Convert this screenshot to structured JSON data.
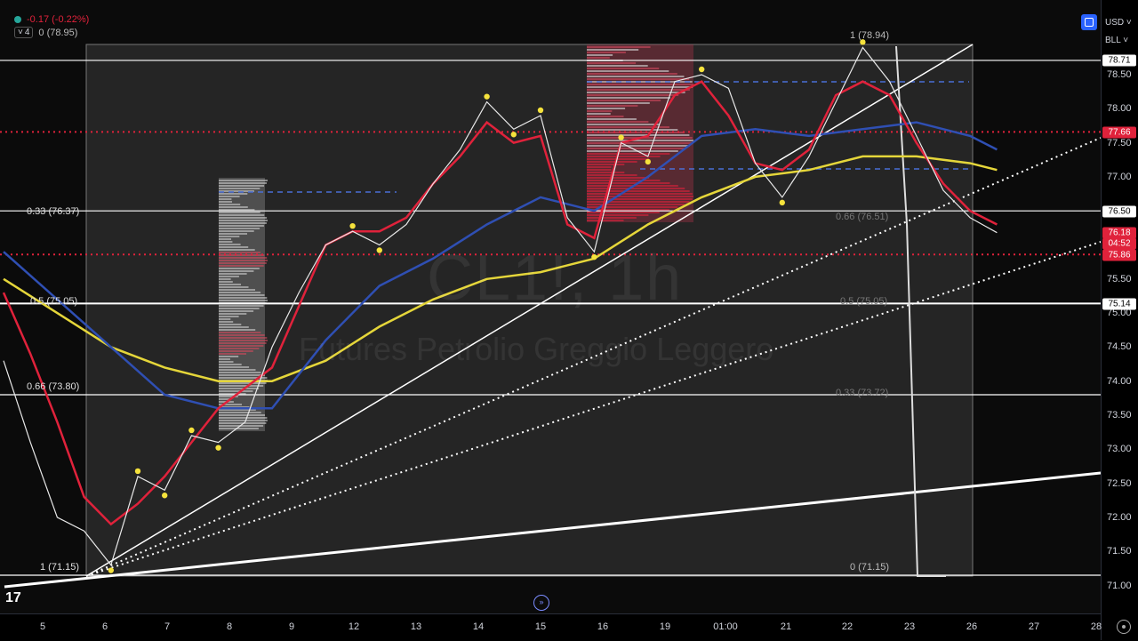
{
  "symbol": {
    "ticker": "CL1!",
    "interval": "1h",
    "name": "Futures Petrolio Greggio Leggero"
  },
  "legend": {
    "change": "-0.17 (-0.22%)",
    "indicators_count": "4",
    "fib_top": "0 (78.95)"
  },
  "top_right": {
    "currency": "USD",
    "unit": "BLL"
  },
  "colors": {
    "accent_red": "#e0223b",
    "ma_yellow": "#e5d63a",
    "ma_blue": "#2f4fb3",
    "line_white": "#ffffff"
  },
  "fib_labels": {
    "left_033": "0.33 (76.37)",
    "left_05": "0.5 (75.05)",
    "left_066": "0.66 (73.80)",
    "left_1": "1 (71.15)",
    "right_1": "1 (78.94)",
    "right_0": "0 (71.15)",
    "right_066": "0.66 (76.51)",
    "right_05": "0.5 (75.05)",
    "right_033": "0.33 (73.72)"
  },
  "price_axis": {
    "ticks": [
      "78.50",
      "78.00",
      "77.50",
      "77.00",
      "76.50",
      "76.00",
      "75.50",
      "75.00",
      "74.50",
      "74.00",
      "73.50",
      "73.00",
      "72.50",
      "72.00",
      "71.50",
      "71.00"
    ],
    "labels": [
      {
        "text": "78.71",
        "kind": "white"
      },
      {
        "text": "77.66",
        "kind": "red"
      },
      {
        "text": "76.50",
        "kind": "white"
      },
      {
        "text": "76.18",
        "kind": "red"
      },
      {
        "text": "04:52",
        "kind": "red"
      },
      {
        "text": "75.86",
        "kind": "red"
      },
      {
        "text": "75.14",
        "kind": "white"
      }
    ]
  },
  "time_axis": {
    "ticks": [
      "5",
      "6",
      "7",
      "8",
      "9",
      "12",
      "13",
      "14",
      "15",
      "16",
      "19",
      "01:00",
      "21",
      "22",
      "23",
      "26",
      "27",
      "28"
    ]
  },
  "chart_data": {
    "type": "line",
    "title": "",
    "ylim": [
      70.85,
      79.4
    ],
    "price_series": [
      {
        "x": 0,
        "p": 74.3
      },
      {
        "x": 1,
        "p": 73.1
      },
      {
        "x": 2,
        "p": 72.0
      },
      {
        "x": 3,
        "p": 71.8
      },
      {
        "x": 4,
        "p": 71.3
      },
      {
        "x": 5,
        "p": 72.6
      },
      {
        "x": 6,
        "p": 72.4
      },
      {
        "x": 7,
        "p": 73.2
      },
      {
        "x": 8,
        "p": 73.1
      },
      {
        "x": 9,
        "p": 73.4
      },
      {
        "x": 10,
        "p": 74.5
      },
      {
        "x": 11,
        "p": 75.3
      },
      {
        "x": 12,
        "p": 76.0
      },
      {
        "x": 13,
        "p": 76.2
      },
      {
        "x": 14,
        "p": 76.0
      },
      {
        "x": 15,
        "p": 76.3
      },
      {
        "x": 16,
        "p": 76.9
      },
      {
        "x": 17,
        "p": 77.4
      },
      {
        "x": 18,
        "p": 78.1
      },
      {
        "x": 19,
        "p": 77.7
      },
      {
        "x": 20,
        "p": 77.9
      },
      {
        "x": 21,
        "p": 76.4
      },
      {
        "x": 22,
        "p": 75.9
      },
      {
        "x": 23,
        "p": 77.5
      },
      {
        "x": 24,
        "p": 77.3
      },
      {
        "x": 25,
        "p": 78.4
      },
      {
        "x": 26,
        "p": 78.5
      },
      {
        "x": 27,
        "p": 78.3
      },
      {
        "x": 28,
        "p": 77.2
      },
      {
        "x": 29,
        "p": 76.7
      },
      {
        "x": 30,
        "p": 77.3
      },
      {
        "x": 31,
        "p": 78.1
      },
      {
        "x": 32,
        "p": 78.9
      },
      {
        "x": 33,
        "p": 78.4
      },
      {
        "x": 34,
        "p": 77.6
      },
      {
        "x": 35,
        "p": 76.8
      },
      {
        "x": 36,
        "p": 76.4
      },
      {
        "x": 37,
        "p": 76.18
      }
    ],
    "red_ma": [
      {
        "x": 0,
        "p": 75.3
      },
      {
        "x": 1,
        "p": 74.4
      },
      {
        "x": 2,
        "p": 73.4
      },
      {
        "x": 3,
        "p": 72.3
      },
      {
        "x": 4,
        "p": 71.9
      },
      {
        "x": 5,
        "p": 72.2
      },
      {
        "x": 6,
        "p": 72.6
      },
      {
        "x": 7,
        "p": 73.1
      },
      {
        "x": 8,
        "p": 73.6
      },
      {
        "x": 9,
        "p": 73.9
      },
      {
        "x": 10,
        "p": 74.2
      },
      {
        "x": 11,
        "p": 75.1
      },
      {
        "x": 12,
        "p": 76.0
      },
      {
        "x": 13,
        "p": 76.2
      },
      {
        "x": 14,
        "p": 76.2
      },
      {
        "x": 15,
        "p": 76.4
      },
      {
        "x": 16,
        "p": 76.9
      },
      {
        "x": 17,
        "p": 77.3
      },
      {
        "x": 18,
        "p": 77.8
      },
      {
        "x": 19,
        "p": 77.5
      },
      {
        "x": 20,
        "p": 77.6
      },
      {
        "x": 21,
        "p": 76.3
      },
      {
        "x": 22,
        "p": 76.1
      },
      {
        "x": 23,
        "p": 77.5
      },
      {
        "x": 24,
        "p": 77.6
      },
      {
        "x": 25,
        "p": 78.2
      },
      {
        "x": 26,
        "p": 78.4
      },
      {
        "x": 27,
        "p": 77.9
      },
      {
        "x": 28,
        "p": 77.2
      },
      {
        "x": 29,
        "p": 77.1
      },
      {
        "x": 30,
        "p": 77.4
      },
      {
        "x": 31,
        "p": 78.2
      },
      {
        "x": 32,
        "p": 78.4
      },
      {
        "x": 33,
        "p": 78.2
      },
      {
        "x": 34,
        "p": 77.5
      },
      {
        "x": 35,
        "p": 76.9
      },
      {
        "x": 36,
        "p": 76.5
      },
      {
        "x": 37,
        "p": 76.3
      }
    ],
    "blue_ma": [
      {
        "x": 0,
        "p": 75.9
      },
      {
        "x": 2,
        "p": 75.2
      },
      {
        "x": 4,
        "p": 74.5
      },
      {
        "x": 6,
        "p": 73.8
      },
      {
        "x": 8,
        "p": 73.6
      },
      {
        "x": 10,
        "p": 73.6
      },
      {
        "x": 12,
        "p": 74.6
      },
      {
        "x": 14,
        "p": 75.4
      },
      {
        "x": 16,
        "p": 75.8
      },
      {
        "x": 18,
        "p": 76.3
      },
      {
        "x": 20,
        "p": 76.7
      },
      {
        "x": 22,
        "p": 76.5
      },
      {
        "x": 24,
        "p": 77.0
      },
      {
        "x": 26,
        "p": 77.6
      },
      {
        "x": 28,
        "p": 77.7
      },
      {
        "x": 30,
        "p": 77.6
      },
      {
        "x": 32,
        "p": 77.7
      },
      {
        "x": 34,
        "p": 77.8
      },
      {
        "x": 36,
        "p": 77.6
      },
      {
        "x": 37,
        "p": 77.4
      }
    ],
    "yellow_ma": [
      {
        "x": 0,
        "p": 75.5
      },
      {
        "x": 2,
        "p": 75.0
      },
      {
        "x": 4,
        "p": 74.5
      },
      {
        "x": 6,
        "p": 74.2
      },
      {
        "x": 8,
        "p": 74.0
      },
      {
        "x": 10,
        "p": 74.0
      },
      {
        "x": 12,
        "p": 74.3
      },
      {
        "x": 14,
        "p": 74.8
      },
      {
        "x": 16,
        "p": 75.2
      },
      {
        "x": 18,
        "p": 75.5
      },
      {
        "x": 20,
        "p": 75.6
      },
      {
        "x": 22,
        "p": 75.8
      },
      {
        "x": 24,
        "p": 76.3
      },
      {
        "x": 26,
        "p": 76.7
      },
      {
        "x": 28,
        "p": 77.0
      },
      {
        "x": 30,
        "p": 77.1
      },
      {
        "x": 32,
        "p": 77.3
      },
      {
        "x": 34,
        "p": 77.3
      },
      {
        "x": 36,
        "p": 77.2
      },
      {
        "x": 37,
        "p": 77.1
      }
    ],
    "hlines": [
      78.71,
      76.5,
      75.14,
      73.8,
      71.15
    ],
    "dashed_red": [
      77.66,
      75.86
    ]
  }
}
